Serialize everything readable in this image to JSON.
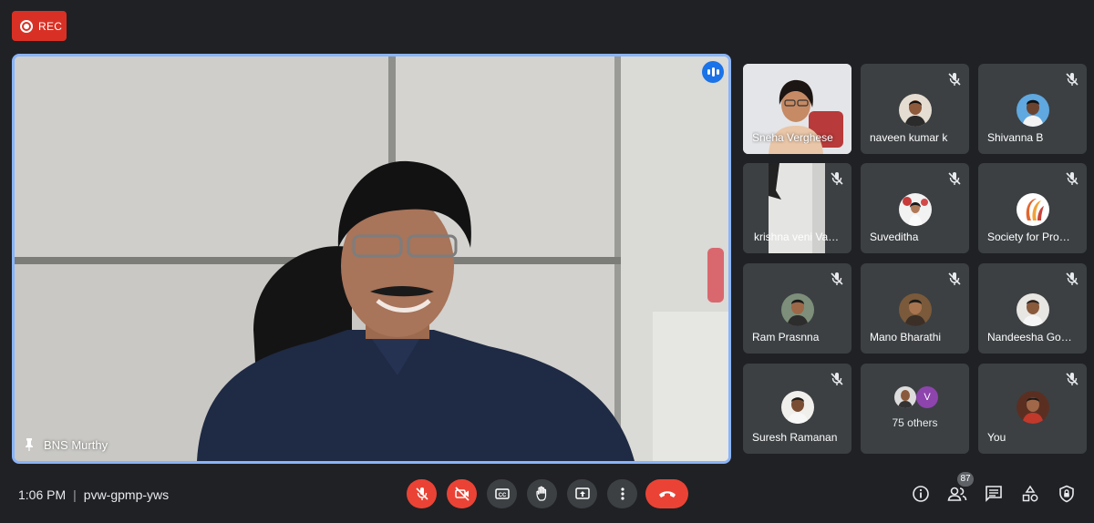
{
  "recording": {
    "label": "REC"
  },
  "main_speaker": {
    "name": "BNS Murthy"
  },
  "participants": [
    {
      "name": "Sneha Verghese",
      "muted": false
    },
    {
      "name": "naveen kumar k",
      "muted": true
    },
    {
      "name": "Shivanna B",
      "muted": true
    },
    {
      "name": "krishna veni Va…",
      "muted": true
    },
    {
      "name": "Suveditha",
      "muted": true
    },
    {
      "name": "Society for Pro…",
      "muted": true
    },
    {
      "name": "Ram Prasnna",
      "muted": true
    },
    {
      "name": "Mano Bharathi",
      "muted": true
    },
    {
      "name": "Nandeesha Go…",
      "muted": true
    },
    {
      "name": "Suresh Ramanan",
      "muted": true
    },
    {
      "name": "You",
      "muted": true
    }
  ],
  "others": {
    "avatar_letter": "V",
    "label": "75 others"
  },
  "footer": {
    "time": "1:06 PM",
    "separator": "|",
    "meeting_code": "pvw-gpmp-yws",
    "people_count": "87"
  },
  "controls": [
    "mic-off-icon",
    "camera-off-icon",
    "captions-icon",
    "raise-hand-icon",
    "present-icon",
    "more-icon",
    "end-call-icon"
  ],
  "right_icons": [
    "info-icon",
    "people-icon",
    "chat-icon",
    "activities-icon",
    "host-controls-icon"
  ],
  "colors": {
    "background": "#202124",
    "tile": "#3c4043",
    "accent": "#8ab4f8",
    "danger": "#ea4335"
  }
}
